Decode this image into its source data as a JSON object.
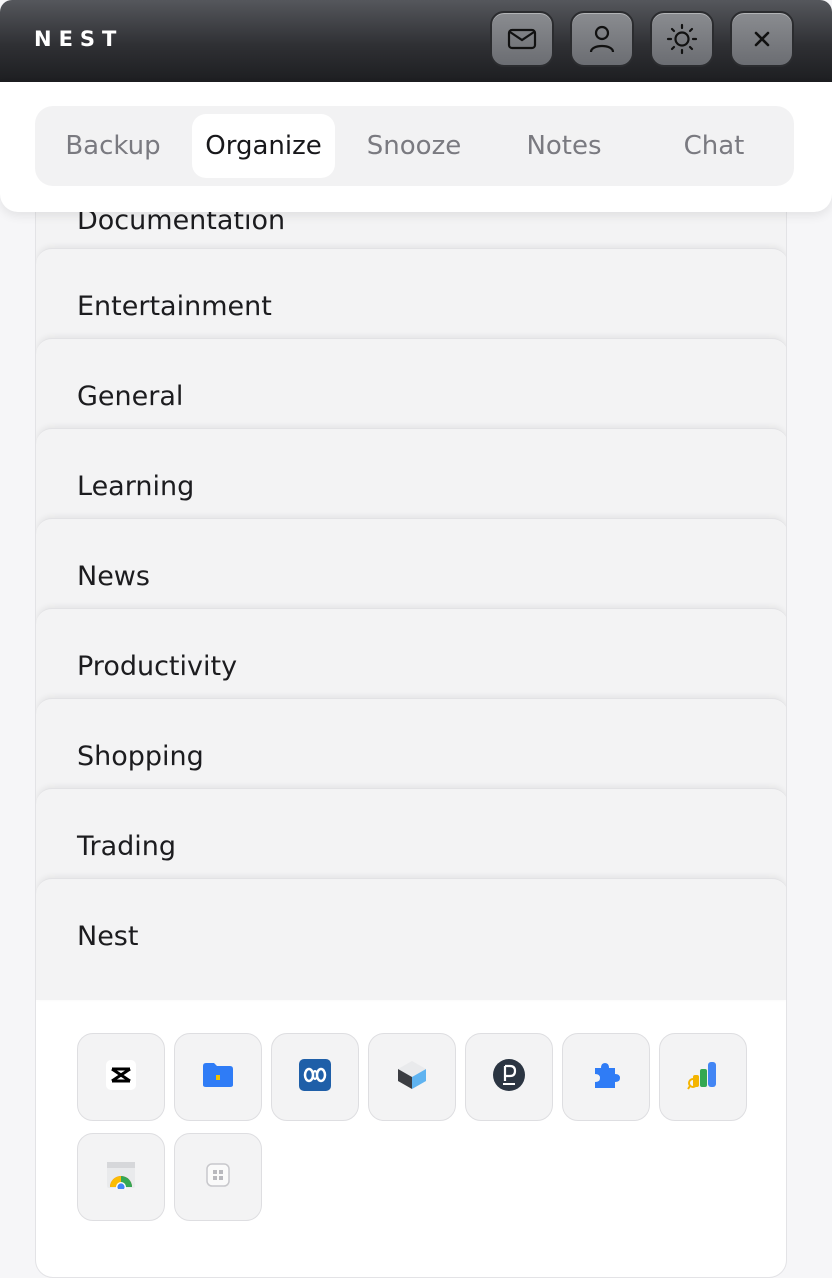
{
  "app": {
    "brand": "NEST"
  },
  "titlebar": {
    "buttons": [
      {
        "name": "mail",
        "icon": "mail-icon"
      },
      {
        "name": "profile",
        "icon": "user-icon"
      },
      {
        "name": "theme",
        "icon": "sun-icon"
      },
      {
        "name": "close",
        "icon": "close-icon"
      }
    ]
  },
  "tabs": [
    {
      "label": "Backup",
      "active": false
    },
    {
      "label": "Organize",
      "active": true
    },
    {
      "label": "Snooze",
      "active": false
    },
    {
      "label": "Notes",
      "active": false
    },
    {
      "label": "Chat",
      "active": false
    }
  ],
  "categories": [
    "Documentation",
    "Entertainment",
    "General",
    "Learning",
    "News",
    "Productivity",
    "Shopping",
    "Trading",
    "Nest"
  ],
  "app_icons": [
    {
      "name": "capcut-icon"
    },
    {
      "name": "folder-lock-icon"
    },
    {
      "name": "infinity-app-icon"
    },
    {
      "name": "cube-box-icon"
    },
    {
      "name": "p-circle-icon"
    },
    {
      "name": "puzzle-extension-icon"
    },
    {
      "name": "analytics-chart-icon"
    },
    {
      "name": "chrome-window-icon"
    },
    {
      "name": "grid-placeholder-icon"
    }
  ],
  "colors": {
    "titlebar": "#2f3034",
    "active_tab": "#ffffff",
    "accent_blue": "#2f7cf6"
  }
}
